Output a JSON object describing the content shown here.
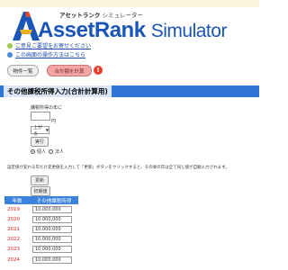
{
  "brand": {
    "name_main": "AssetRank",
    "name_sub": "Simulator",
    "name_jp": "アセットランク",
    "name_jp_sub": "シミュレーター"
  },
  "links": {
    "feedback": "ご意見ご要望をお寄せください",
    "howto": "この画面の操作方法はこちら"
  },
  "buttons": {
    "list": "物件一覧",
    "calc": "合計額を計算",
    "help": "!"
  },
  "section": {
    "title": "その他課税所得入力(合計計算用)"
  },
  "form": {
    "base_label": "課税所得の年に",
    "yen_unit": "円",
    "select_value": "上がる",
    "run_button": "実行",
    "radio_personal": "個人",
    "radio_corporate": "法人",
    "radio_selected": "個人",
    "note": "設定値が変わる年だけ変更値を入力して「更新」ボタンをクリックすると、その後の年は全て同じ値が自動入力されます。",
    "update_button": "更新",
    "reset_button": "初期値"
  },
  "table": {
    "col_year": "年数",
    "col_income": "その他課税所得",
    "rows": [
      {
        "year": "2019",
        "value": "10,000,000"
      },
      {
        "year": "2020",
        "value": "10,000,000"
      },
      {
        "year": "2021",
        "value": "10,000,000"
      },
      {
        "year": "2022",
        "value": "10,000,000"
      },
      {
        "year": "2023",
        "value": "10,000,000"
      },
      {
        "year": "2024",
        "value": "10,000,000"
      }
    ]
  },
  "colors": {
    "accent_blue": "#2f75d8",
    "brand_blue": "#1a56b8",
    "calc_pink": "#f4a6a6",
    "year_red": "#e02020",
    "help_red": "#e8402c"
  }
}
